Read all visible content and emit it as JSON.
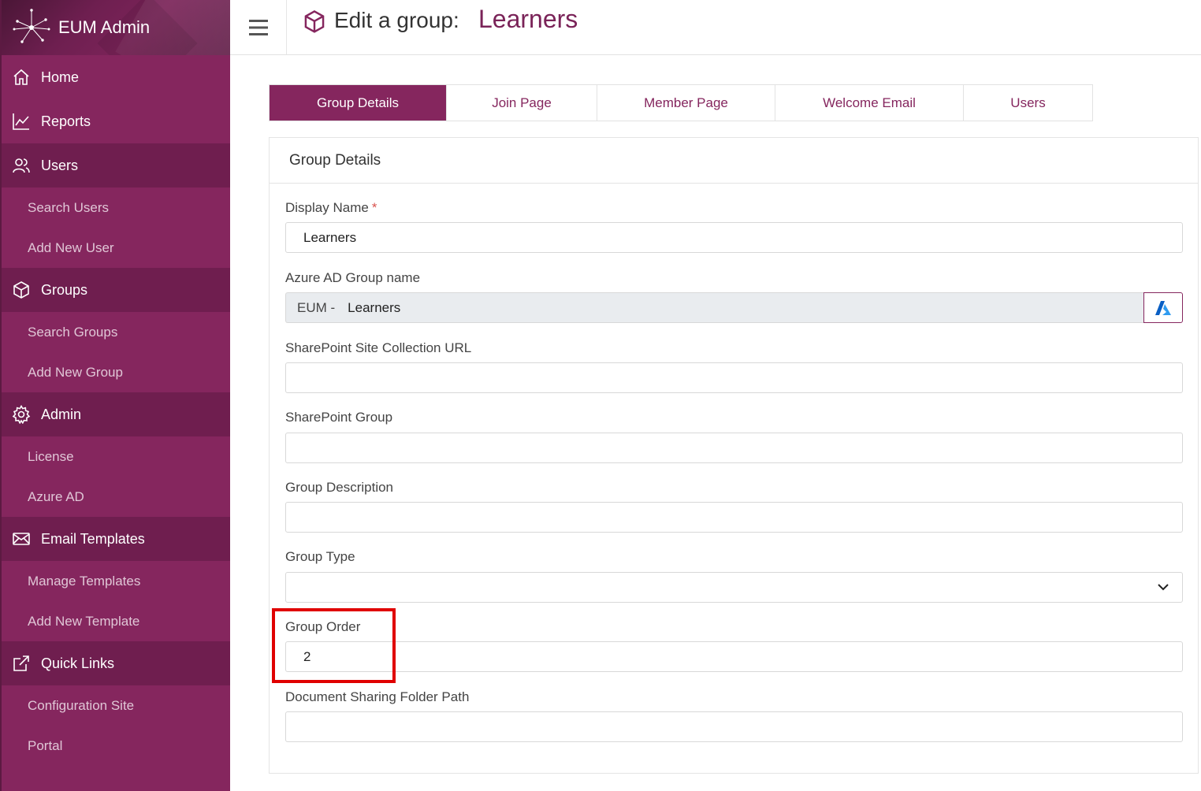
{
  "app": {
    "title": "EUM Admin"
  },
  "sidebar": {
    "sections": [
      {
        "label": "Home",
        "icon": "home-icon"
      },
      {
        "label": "Reports",
        "icon": "chart-line-icon"
      },
      {
        "label": "Users",
        "icon": "users-icon",
        "items": [
          "Search Users",
          "Add New User"
        ]
      },
      {
        "label": "Groups",
        "icon": "cube-icon",
        "items": [
          "Search Groups",
          "Add New Group"
        ]
      },
      {
        "label": "Admin",
        "icon": "gear-icon",
        "items": [
          "License",
          "Azure AD"
        ]
      },
      {
        "label": "Email Templates",
        "icon": "envelope-icon",
        "items": [
          "Manage Templates",
          "Add New Template"
        ]
      },
      {
        "label": "Quick Links",
        "icon": "external-link-icon",
        "items": [
          "Configuration Site",
          "Portal"
        ]
      }
    ]
  },
  "header": {
    "heading": "Edit a group:",
    "group_name": "Learners"
  },
  "tabs": [
    "Group Details",
    "Join Page",
    "Member Page",
    "Welcome Email",
    "Users"
  ],
  "active_tab": "Group Details",
  "card": {
    "title": "Group Details",
    "fields": {
      "display_name": {
        "label": "Display Name",
        "required_mark": "*",
        "value": "Learners"
      },
      "azure_group": {
        "label": "Azure AD Group name",
        "prefix": "EUM -",
        "value": "Learners"
      },
      "sharepoint_url": {
        "label": "SharePoint Site Collection URL",
        "value": ""
      },
      "sharepoint_group": {
        "label": "SharePoint Group",
        "value": ""
      },
      "group_description": {
        "label": "Group Description",
        "value": ""
      },
      "group_type": {
        "label": "Group Type",
        "value": ""
      },
      "group_order": {
        "label": "Group Order",
        "value": "2"
      },
      "doc_folder": {
        "label": "Document Sharing Folder Path",
        "value": ""
      }
    }
  },
  "colors": {
    "brand": "#85265e",
    "brand_dark": "#6f1e4f",
    "highlight": "#e00000"
  }
}
